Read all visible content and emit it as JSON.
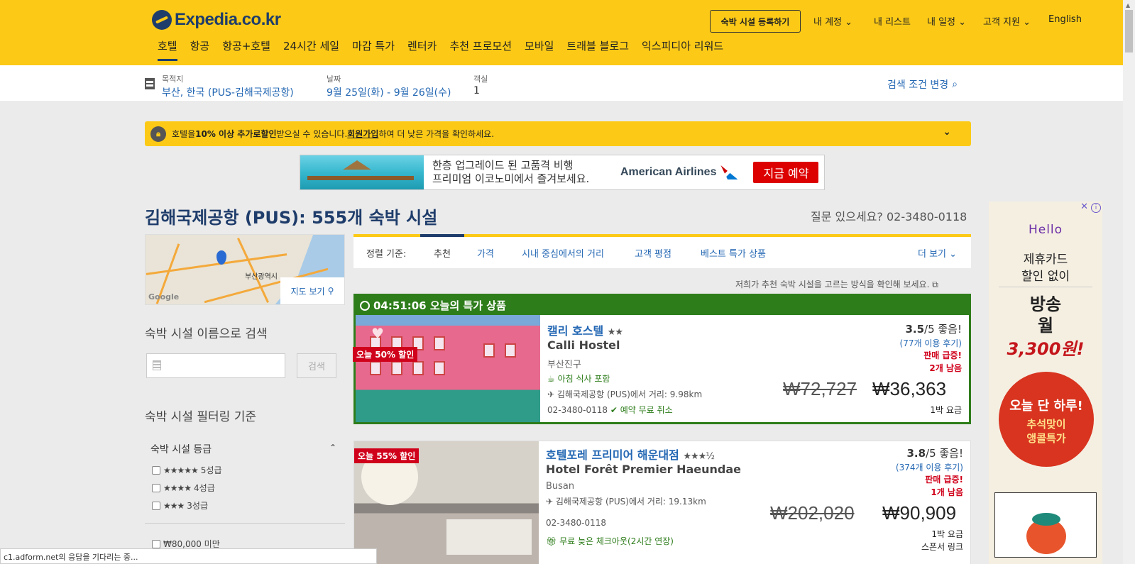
{
  "header": {
    "logo_text": "Expedia.co.kr",
    "register_button": "숙박 시설 등록하기",
    "account": "내 계정",
    "my_list": "내 리스트",
    "my_trips": "내 일정",
    "support": "고객 지원",
    "language": "English",
    "nav": [
      "호텔",
      "항공",
      "항공+호텔",
      "24시간 세일",
      "마감 특가",
      "렌터카",
      "추천 프로모션",
      "모바일",
      "트래블 블로그",
      "익스피디아 리워드"
    ],
    "active_nav": "호텔"
  },
  "search_summary": {
    "destination_label": "목적지",
    "destination_value": "부산, 한국 (PUS-김해국제공항)",
    "date_label": "날짜",
    "date_value": "9월 25일(화) - 9월 26일(수)",
    "rooms_label": "객실",
    "rooms_value": "1",
    "change_search": "검색 조건 변경"
  },
  "notice": {
    "t1": "호텔을 ",
    "t2": "10% 이상 추가로",
    "t3": " 할인",
    "t4": "받으실 수 있습니다. ",
    "link": "회원가입",
    "t5": "하여 더 낮은 가격을 확인하세요."
  },
  "banner": {
    "line1": "한층 업그레이드 된 고품격 비행",
    "line2": "프리미엄 이코노미에서 즐겨보세요.",
    "brand": "American Airlines",
    "cta": "지금 예약"
  },
  "results": {
    "title": "김해국제공항 (PUS): 555개 숙박 시설",
    "phone_question": "질문 있으세요? 02-3480-0118"
  },
  "sidebar": {
    "map_city": "부산광역시",
    "map_button": "지도 보기",
    "name_search_heading": "숙박 시설 이름으로 검색",
    "name_search_placeholder": "",
    "search_button": "검색",
    "filter_heading": "숙박 시설 필터링 기준",
    "star_filter_title": "숙박 시설 등급",
    "star_filters": [
      {
        "stars": "★★★★★",
        "label": "5성급"
      },
      {
        "stars": "★★★★",
        "label": "4성급"
      },
      {
        "stars": "★★★",
        "label": "3성급"
      }
    ],
    "price_filter": "₩80,000 미만"
  },
  "sort": {
    "label": "정렬 기준:",
    "options": [
      "추천",
      "가격",
      "시내 중심에서의 거리",
      "고객 평점",
      "베스트 특가 상품"
    ],
    "more": "더 보기",
    "note": "저희가 추천 숙박 시설을 고르는 방식을 확인해 보세요."
  },
  "hotels": [
    {
      "deal_header": "04:51:06 오늘의 특가 상품",
      "badge": "오늘 50% 할인",
      "name_ko": "캘리 호스텔",
      "stars": "★★",
      "name_en": "Calli Hostel",
      "location": "부산진구",
      "amenity": "아침 식사 포함",
      "distance": "김해국제공항 (PUS)에서 거리: 9.98km",
      "phone": "02-3480-0118",
      "cancel": "예약 무료 취소",
      "rating": "3.5",
      "rating_suffix": "/5 좋음!",
      "reviews": "(77개 이용 후기)",
      "urgent1": "판매 급증!",
      "urgent2": "2개 남음",
      "price_old": "₩72,727",
      "price_new": "₩36,363",
      "per_night": "1박 요금"
    },
    {
      "badge": "오늘 55% 할인",
      "name_ko": "호텔포레 프리미어 해운대점",
      "stars": "★★★½",
      "name_en": "Hotel Forêt Premier Haeundae",
      "location": "Busan",
      "distance": "김해국제공항 (PUS)에서 거리: 19.13km",
      "phone": "02-3480-0118",
      "amenity": "무료 늦은 체크아웃(2시간 연장)",
      "rating": "3.8",
      "rating_suffix": "/5 좋음!",
      "reviews": "(374개 이용 후기)",
      "urgent1": "판매 급증!",
      "urgent2": "1개 남음",
      "price_old": "₩202,020",
      "price_new": "₩90,909",
      "per_night": "1박 요금",
      "sponsored": "스폰서 링크"
    }
  ],
  "side_ad": {
    "brand": "Hello",
    "line1": "제휴카드",
    "line2": "할인 없이",
    "big1": "방송",
    "big2": "월",
    "price": "3,300원!",
    "circle1": "오늘 단 하루!",
    "circle2": "추석맞이",
    "circle3": "앵콜특가"
  },
  "status_bar": "c1.adform.net의 응답을 기다리는 중..."
}
